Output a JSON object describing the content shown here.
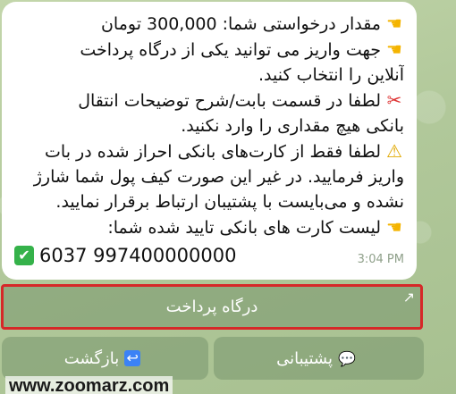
{
  "message": {
    "lines": [
      {
        "icon": "pointing-hand",
        "text": "مقدار درخواستی شما: 300,000 تومان"
      },
      {
        "icon": "pointing-hand",
        "text": "جهت واریز می توانید یکی از درگاه پرداخت"
      },
      {
        "icon": "",
        "text": "آنلاین را انتخاب کنید."
      },
      {
        "icon": "scissors",
        "text": "لطفا در قسمت بابت/شرح توضیحات انتقال"
      },
      {
        "icon": "",
        "text": "بانکی هیچ مقداری را وارد نکنید."
      },
      {
        "icon": "warning",
        "text": "لطفا فقط از کارت‌های بانکی احراز شده در بات"
      },
      {
        "icon": "",
        "text": "واریز فرمایید. در غیر این صورت کیف پول شما شارژ"
      },
      {
        "icon": "",
        "text": "نشده و می‌بایست با پشتیبان ارتباط برقرار نمایید."
      },
      {
        "icon": "pointing-hand",
        "text": "لیست کارت های بانکی تایید شده شما:"
      }
    ],
    "card_number": "6037 997400000000",
    "card_status_icon": "check-mark",
    "time": "3:04 PM"
  },
  "buttons": {
    "gateway": "درگاه پرداخت",
    "support": "پشتیبانی",
    "back": "بازگشت"
  },
  "watermark": "www.zoomarz.com"
}
